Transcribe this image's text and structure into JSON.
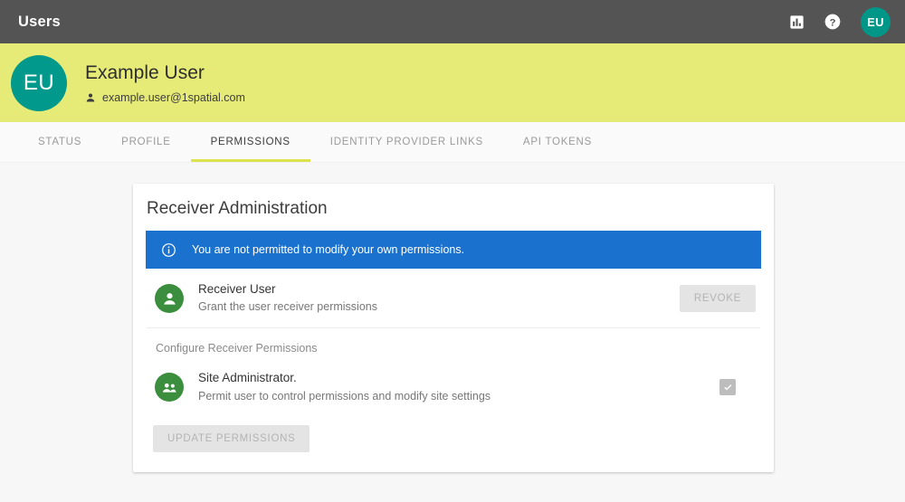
{
  "appbar": {
    "title": "Users",
    "icons": [
      {
        "name": "assessment-icon",
        "label": "Assessment"
      },
      {
        "name": "help-icon",
        "label": "Help"
      }
    ],
    "avatar_initials": "EU",
    "background_color": "#545454",
    "avatar_color": "#009688"
  },
  "hero": {
    "initials": "EU",
    "name": "Example User",
    "email": "example.user@1spatial.com",
    "person_icon": "person-icon",
    "background_color": "#e6eb77",
    "avatar_color": "#00998c"
  },
  "tabs": [
    {
      "label": "STATUS",
      "active": false
    },
    {
      "label": "PROFILE",
      "active": false
    },
    {
      "label": "PERMISSIONS",
      "active": true
    },
    {
      "label": "IDENTITY PROVIDER LINKS",
      "active": false
    },
    {
      "label": "API TOKENS",
      "active": false
    }
  ],
  "tab_accent_color": "#dce34d",
  "card": {
    "title": "Receiver Administration",
    "alert": {
      "icon": "info-circle-icon",
      "message": "You are not permitted to modify your own permissions.",
      "color": "#1b72ce"
    },
    "receiver_user": {
      "icon": "account-circle-icon",
      "title": "Receiver User",
      "description": "Grant the user receiver permissions",
      "action_label": "REVOKE",
      "action_disabled": true
    },
    "section_label": "Configure Receiver Permissions",
    "site_administrator": {
      "icon": "group-icon",
      "title": "Site Administrator.",
      "description": "Permit user to control permissions and modify site settings",
      "checked": true,
      "checkbox_disabled": true
    },
    "update_button": {
      "label": "UPDATE PERMISSIONS",
      "disabled": true
    },
    "icon_color": "#3a8e3d"
  }
}
